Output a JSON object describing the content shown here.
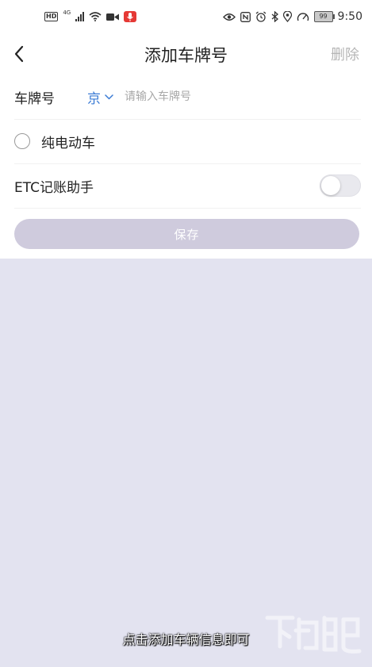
{
  "status_bar": {
    "left": {
      "hd": "HD",
      "network": "4G"
    },
    "battery": "99",
    "time": "9:50"
  },
  "header": {
    "title": "添加车牌号",
    "delete_label": "删除"
  },
  "form": {
    "plate_label": "车牌号",
    "province": "京",
    "plate_placeholder": "请输入车牌号",
    "plate_value": "",
    "ev_label": "纯电动车",
    "ev_checked": false,
    "etc_label": "ETC记账助手",
    "etc_enabled": false,
    "save_label": "保存"
  },
  "caption": "点击添加车辆信息即可",
  "colors": {
    "accent": "#3a7bd5",
    "save_disabled": "#cfcbdd",
    "background": "#e3e3f0",
    "recording": "#e53935"
  },
  "icons": {
    "back": "chevron-left-icon",
    "province_dropdown": "chevron-down-icon",
    "wifi": "wifi-icon",
    "camera": "video-camera-icon",
    "mic": "microphone-icon",
    "eye": "eye-icon",
    "nfc": "nfc-icon",
    "alarm": "alarm-icon",
    "bluetooth": "bluetooth-icon",
    "location": "location-icon",
    "speed": "speedometer-icon"
  }
}
